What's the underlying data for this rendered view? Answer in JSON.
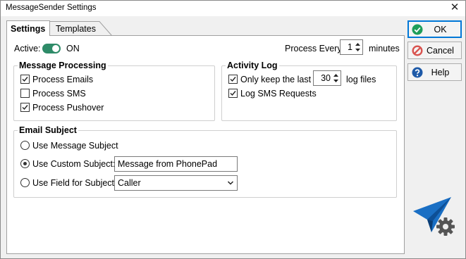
{
  "window": {
    "title": "MessageSender Settings",
    "close_glyph": "✕"
  },
  "tabs": [
    {
      "label": "Settings",
      "active": true
    },
    {
      "label": "Templates",
      "active": false
    }
  ],
  "settings": {
    "active_label": "Active:",
    "active_state": "ON",
    "process_every_label": "Process Every",
    "process_every_value": "1",
    "process_every_unit": "minutes",
    "message_processing": {
      "title": "Message Processing",
      "items": [
        {
          "label": "Process Emails",
          "checked": true
        },
        {
          "label": "Process SMS",
          "checked": false
        },
        {
          "label": "Process Pushover",
          "checked": true
        }
      ]
    },
    "activity_log": {
      "title": "Activity Log",
      "keep_label": "Only keep the last",
      "keep_value": "30",
      "keep_unit": "log files",
      "keep_checked": true,
      "log_sms_label": "Log SMS Requests",
      "log_sms_checked": true
    },
    "email_subject": {
      "title": "Email Subject",
      "options": [
        {
          "label": "Use Message Subject",
          "selected": false
        },
        {
          "label": "Use Custom Subject:",
          "selected": true
        },
        {
          "label": "Use Field for Subject:",
          "selected": false
        }
      ],
      "custom_subject_value": "Message from PhonePad",
      "field_selected": "Caller"
    }
  },
  "buttons": {
    "ok": "OK",
    "cancel": "Cancel",
    "help": "Help"
  },
  "icons": {
    "ok": "check-circle-icon",
    "cancel": "no-entry-icon",
    "help": "help-circle-icon",
    "logo": "paper-plane-gear-icon"
  },
  "colors": {
    "accent": "#2e8b68",
    "ok_icon": "#1e9e5a",
    "cancel_icon": "#d9534f",
    "help_icon": "#1e5aa8",
    "logo_blue": "#1a6fc4",
    "logo_gear": "#555555"
  }
}
